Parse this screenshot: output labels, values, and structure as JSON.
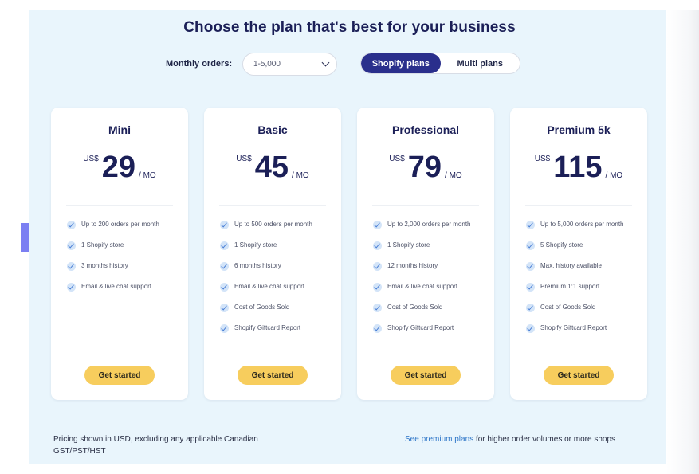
{
  "title": "Choose the plan that's best for your business",
  "orders": {
    "label": "Monthly orders:",
    "selected": "1-5,000"
  },
  "toggle": {
    "options": [
      "Shopify plans",
      "Multi plans"
    ],
    "active": "Shopify plans"
  },
  "plans": [
    {
      "name": "Mini",
      "currency": "US$",
      "price": "29",
      "period": "/ MO",
      "features": [
        "Up to 200 orders per month",
        "1 Shopify store",
        "3 months history",
        "Email & live chat support"
      ],
      "cta": "Get started"
    },
    {
      "name": "Basic",
      "currency": "US$",
      "price": "45",
      "period": "/ MO",
      "features": [
        "Up to 500 orders per month",
        "1 Shopify store",
        "6 months history",
        "Email & live chat support",
        "Cost of Goods Sold",
        "Shopify Giftcard Report"
      ],
      "cta": "Get started"
    },
    {
      "name": "Professional",
      "currency": "US$",
      "price": "79",
      "period": "/ MO",
      "features": [
        "Up to 2,000 orders per month",
        "1 Shopify store",
        "12 months history",
        "Email & live chat support",
        "Cost of Goods Sold",
        "Shopify Giftcard Report"
      ],
      "cta": "Get started"
    },
    {
      "name": "Premium 5k",
      "currency": "US$",
      "price": "115",
      "period": "/ MO",
      "features": [
        "Up to 5,000 orders per month",
        "5 Shopify store",
        "Max. history available",
        "Premium 1:1 support",
        "Cost of Goods Sold",
        "Shopify Giftcard Report"
      ],
      "cta": "Get started"
    }
  ],
  "footer": {
    "pricing_note": "Pricing shown in USD, excluding any applicable Canadian GST/PST/HST",
    "premium_link": "See premium plans",
    "premium_suffix": " for higher order volumes or more shops"
  },
  "colors": {
    "panel_bg": "#e9f5fc",
    "brand_navy": "#2a2f8c",
    "cta_yellow": "#f7cd5d",
    "link_blue": "#2e76c8",
    "side_tab": "#7b7ff2"
  }
}
